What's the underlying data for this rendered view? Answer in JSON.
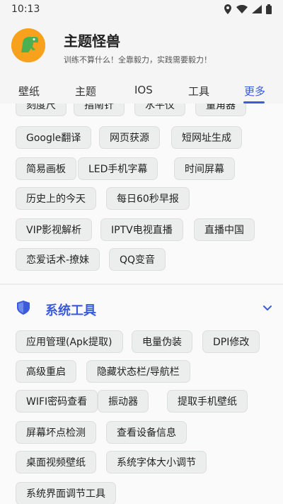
{
  "status_bar": {
    "time": "10:13"
  },
  "header": {
    "title": "主题怪兽",
    "slogan": "训练不算什么！全靠毅力，实践需要毅力！",
    "logo_text": "主题怪兽"
  },
  "tabs": [
    {
      "label": "壁纸"
    },
    {
      "label": "主题"
    },
    {
      "label": "IOS"
    },
    {
      "label": "工具"
    },
    {
      "label": "更多",
      "active": true
    }
  ],
  "top_tools": [
    {
      "label": "刻度尺"
    },
    {
      "label": "指南针"
    },
    {
      "label": "水平仪"
    },
    {
      "label": "量角器"
    },
    {
      "label": "Google翻译"
    },
    {
      "label": "网页获源"
    },
    {
      "label": "短网址生成"
    },
    {
      "label": "简易画板"
    },
    {
      "label": "LED手机字幕"
    },
    {
      "label": "时间屏幕"
    },
    {
      "label": "历史上的今天"
    },
    {
      "label": "每日60秒早报"
    },
    {
      "label": "VIP影视解析"
    },
    {
      "label": "IPTV电视直播"
    },
    {
      "label": "直播中国"
    },
    {
      "label": "恋爱话术-撩妹"
    },
    {
      "label": "QQ变音"
    }
  ],
  "system_section": {
    "title": "系统工具",
    "items": [
      {
        "label": "应用管理(Apk提取)"
      },
      {
        "label": "电量伪装"
      },
      {
        "label": "DPI修改"
      },
      {
        "label": "高级重启"
      },
      {
        "label": "隐藏状态栏/导航栏"
      },
      {
        "label": "WIFI密码查看"
      },
      {
        "label": "振动器"
      },
      {
        "label": "提取手机壁纸"
      },
      {
        "label": "屏幕坏点检测"
      },
      {
        "label": "查看设备信息"
      },
      {
        "label": "桌面视频壁纸"
      },
      {
        "label": "系统字体大小调节"
      },
      {
        "label": "系统界面调节工具"
      }
    ]
  },
  "colors": {
    "accent": "#3b5bdb",
    "chip_bg": "#eceded",
    "logo_bg": "#f7a11c"
  }
}
